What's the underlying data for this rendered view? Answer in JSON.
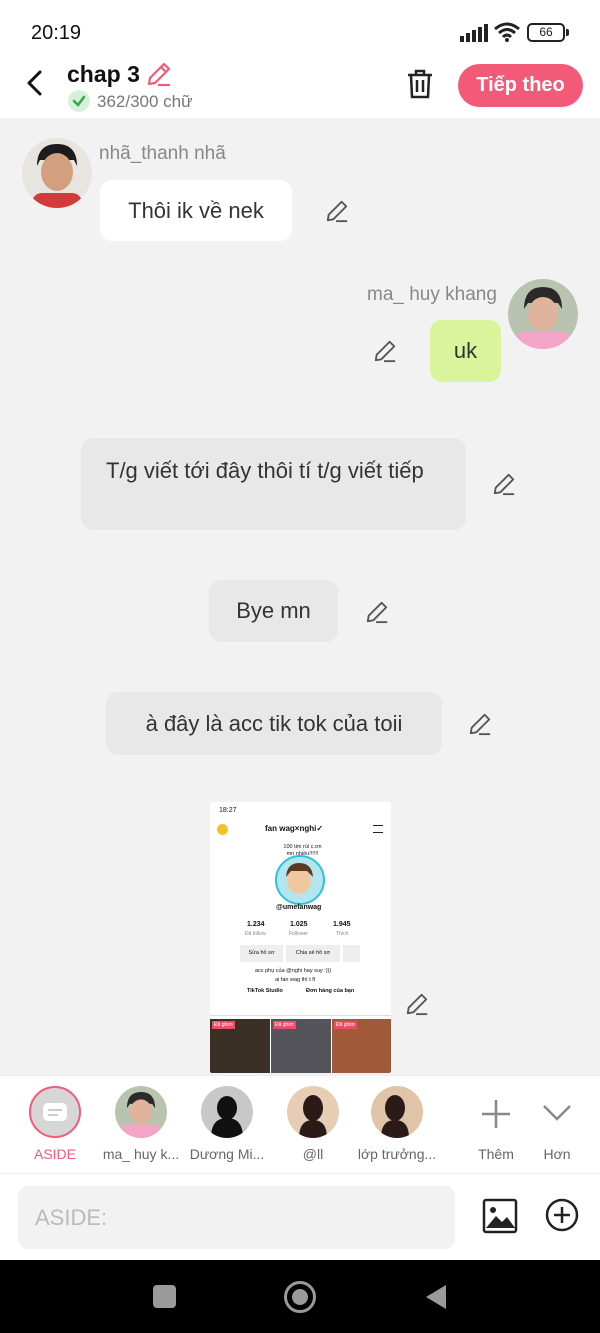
{
  "status_bar": {
    "time": "20:19",
    "battery": "66"
  },
  "header": {
    "title": "chap 3",
    "word_count": "362/300 chữ",
    "next_label": "Tiếp theo"
  },
  "messages": [
    {
      "sender": "nhã_thanh nhã",
      "text": "Thôi ik về nek"
    },
    {
      "sender": "ma_ huy khang",
      "text": "uk"
    },
    {
      "text": "T/g viết tới đây thôi tí t/g viết tiếp"
    },
    {
      "text": "Bye mn"
    },
    {
      "text": "à đây là acc tik tok của toii"
    }
  ],
  "screenshot_image": {
    "time": "18:27",
    "username": "fan wag×nghi✓",
    "bio_top": "100 tim rùi c.ơn mn nhiều!!!!!!",
    "handle": "@umefanwag",
    "stats": [
      {
        "value": "1.234",
        "label": "Đã follow"
      },
      {
        "value": "1.025",
        "label": "Follower"
      },
      {
        "value": "1.945",
        "label": "Thích"
      }
    ],
    "buttons": [
      "Sửa hồ sơ",
      "Chia sẻ hồ sơ"
    ],
    "bio_line1": "acc phụ của @nghi hay suy :)))",
    "bio_line2": "ai fan wag thì t fl",
    "link1": "TikTok Studio",
    "link2": "Đơn hàng của bạn",
    "pin_label": "Đã ghim"
  },
  "characters": [
    {
      "label": "ASIDE"
    },
    {
      "label": "ma_ huy k..."
    },
    {
      "label": "Dương Mi..."
    },
    {
      "label": "@ll"
    },
    {
      "label": "lớp trưởng..."
    },
    {
      "label": "Thêm"
    },
    {
      "label": "Hơn"
    }
  ],
  "input": {
    "placeholder": "ASIDE:"
  },
  "colors": {
    "accent": "#f25a78",
    "right_bubble": "#d9f49a",
    "bubble_gray": "#e8e8e8"
  }
}
